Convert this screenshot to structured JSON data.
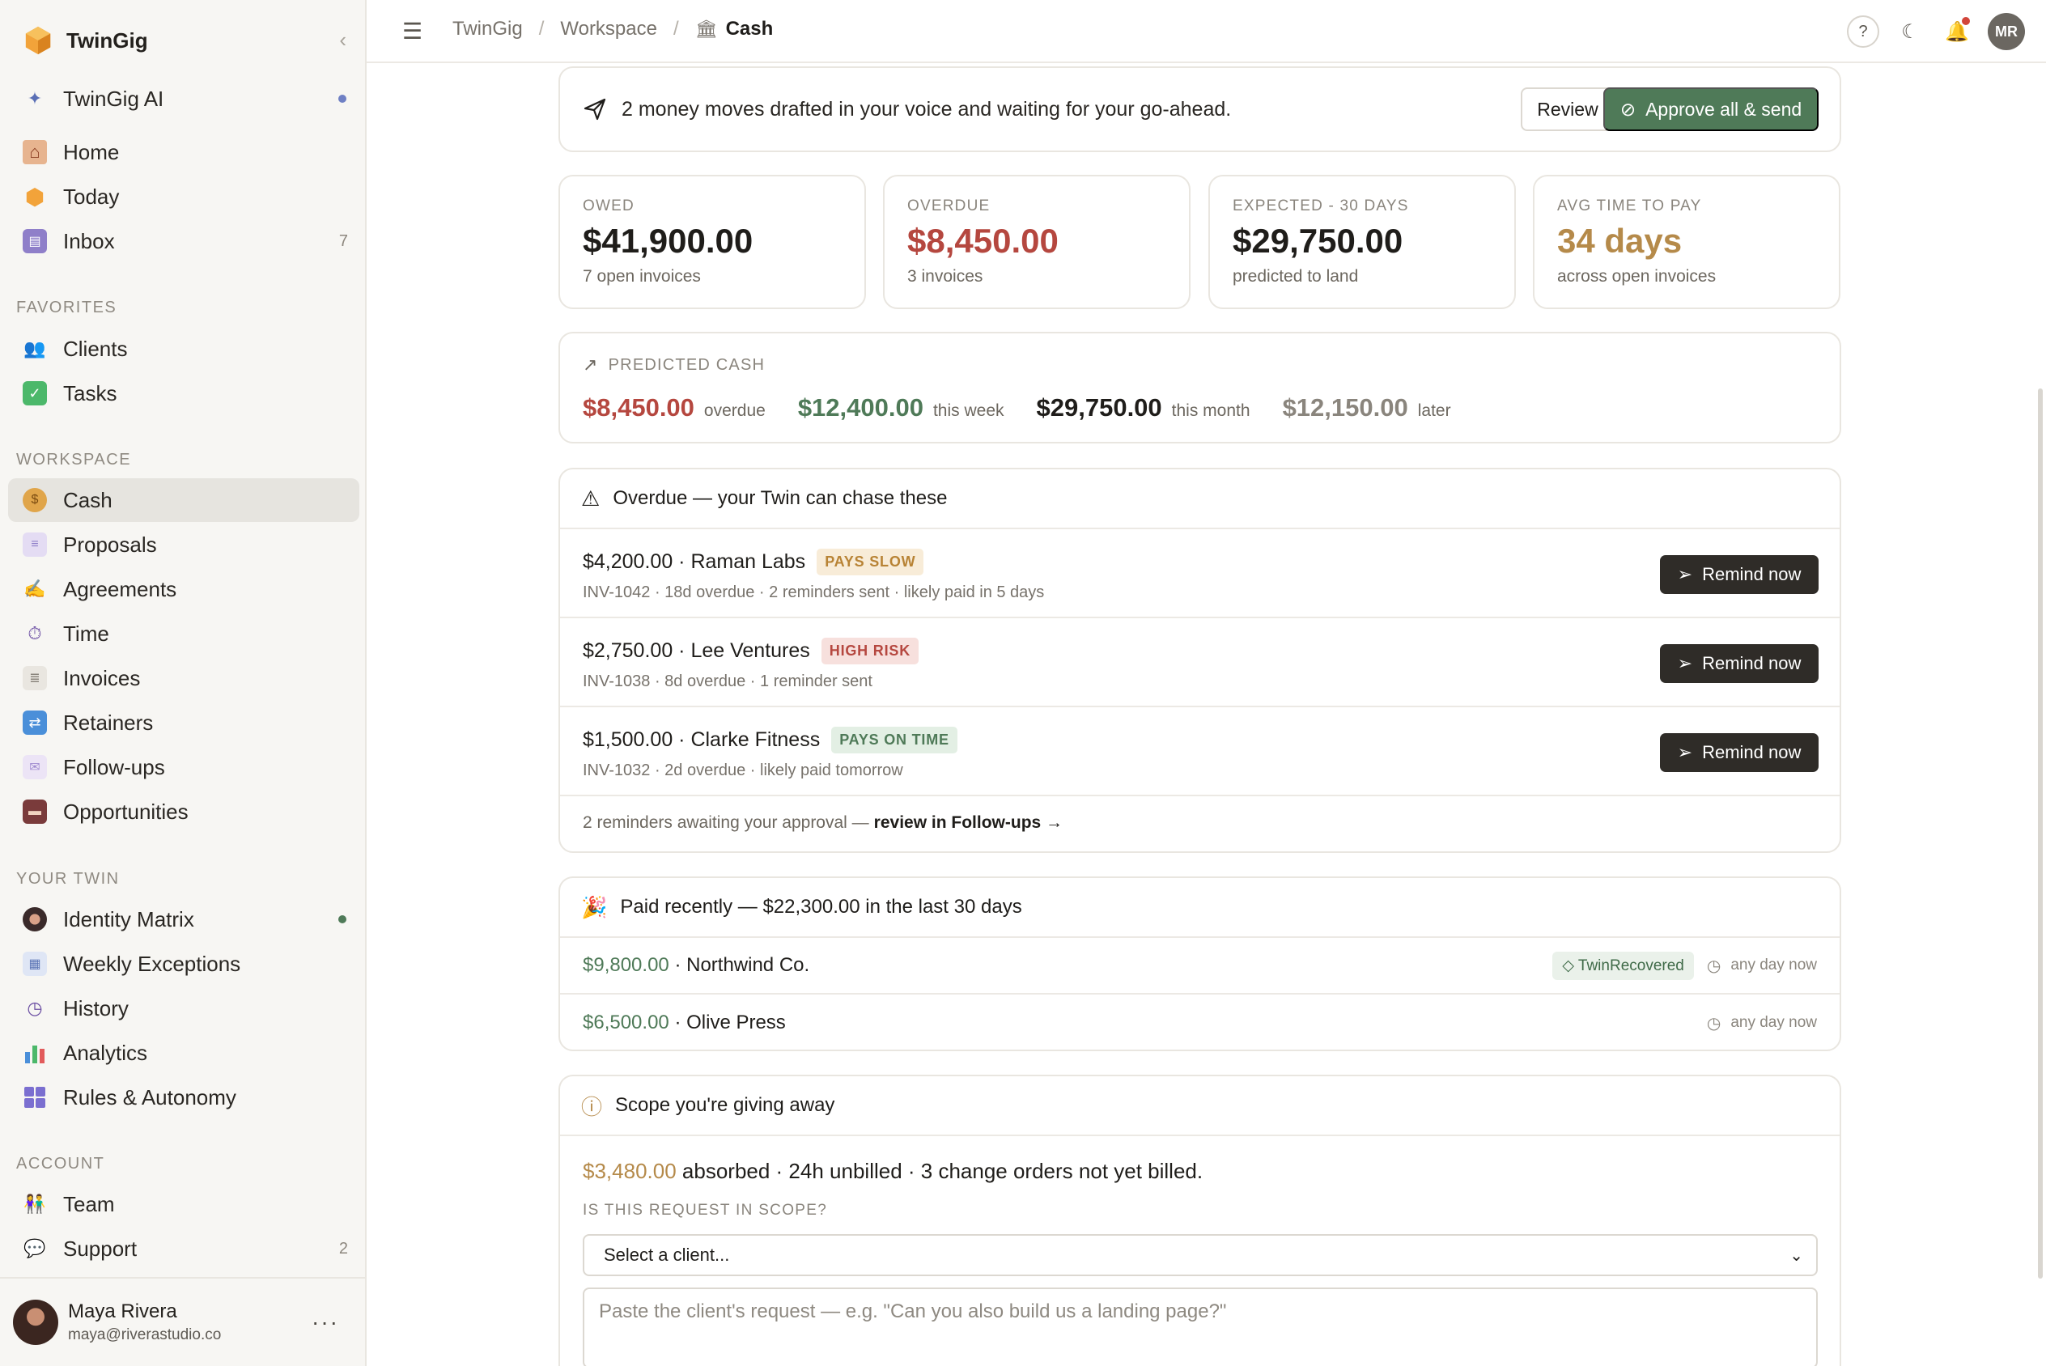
{
  "app": {
    "name": "TwinGig"
  },
  "sidebar": {
    "ai_item": {
      "label": "TwinGig AI"
    },
    "top_items": [
      {
        "label": "Home",
        "icon": "house-icon"
      },
      {
        "label": "Today",
        "icon": "hexagon-icon"
      },
      {
        "label": "Inbox",
        "icon": "inbox-icon",
        "count": "7"
      }
    ],
    "sections": {
      "favorites": "FAVORITES",
      "workspace": "WORKSPACE",
      "your_twin": "YOUR TWIN",
      "account": "ACCOUNT"
    },
    "favorites": [
      {
        "label": "Clients",
        "icon": "people-icon"
      },
      {
        "label": "Tasks",
        "icon": "check-box-icon"
      }
    ],
    "workspace": [
      {
        "label": "Cash",
        "icon": "money-bag-icon",
        "active": true
      },
      {
        "label": "Proposals",
        "icon": "document-icon"
      },
      {
        "label": "Agreements",
        "icon": "writing-hand-icon"
      },
      {
        "label": "Time",
        "icon": "stopwatch-icon"
      },
      {
        "label": "Invoices",
        "icon": "receipt-icon"
      },
      {
        "label": "Retainers",
        "icon": "repeat-icon"
      },
      {
        "label": "Follow-ups",
        "icon": "envelope-icon"
      },
      {
        "label": "Opportunities",
        "icon": "briefcase-icon"
      }
    ],
    "your_twin": [
      {
        "label": "Identity Matrix",
        "icon": "identity-icon"
      },
      {
        "label": "Weekly Exceptions",
        "icon": "calendar-icon"
      },
      {
        "label": "History",
        "icon": "clock-icon"
      },
      {
        "label": "Analytics",
        "icon": "bar-chart-icon"
      },
      {
        "label": "Rules & Autonomy",
        "icon": "grid-icon"
      }
    ],
    "account": [
      {
        "label": "Team",
        "icon": "team-icon"
      },
      {
        "label": "Support",
        "icon": "speech-bubble-icon",
        "count": "2"
      }
    ],
    "user": {
      "name": "Maya Rivera",
      "email": "maya@riverastudio.co"
    }
  },
  "topbar": {
    "breadcrumb": [
      "TwinGig",
      "Workspace",
      "Cash"
    ],
    "initials": "MR"
  },
  "banner": {
    "text": "2 money moves drafted in your voice and waiting for your go-ahead.",
    "review_label": "Review",
    "approve_label": "Approve all & send"
  },
  "kpis": [
    {
      "label": "OWED",
      "value": "$41,900.00",
      "sub": "7 open invoices",
      "color": "#1f1d1a"
    },
    {
      "label": "OVERDUE",
      "value": "$8,450.00",
      "sub": "3 invoices",
      "color": "#b5473f"
    },
    {
      "label": "EXPECTED - 30 DAYS",
      "value": "$29,750.00",
      "sub": "predicted to land",
      "color": "#1f1d1a"
    },
    {
      "label": "AVG TIME TO PAY",
      "value": "34 days",
      "sub": "across open invoices",
      "color": "#b58a4a"
    }
  ],
  "predicted": {
    "title": "PREDICTED CASH",
    "buckets": [
      {
        "amount": "$8,450.00",
        "label": "overdue",
        "color": "#b5473f"
      },
      {
        "amount": "$12,400.00",
        "label": "this week",
        "color": "#4f7a58"
      },
      {
        "amount": "$29,750.00",
        "label": "this month",
        "color": "#1f1d1a"
      },
      {
        "amount": "$12,150.00",
        "label": "later",
        "color": "#8a857d"
      }
    ]
  },
  "overdue": {
    "title": "Overdue — your Twin can chase these",
    "remind_label": "Remind now",
    "rows": [
      {
        "amount": "$4,200.00",
        "client": "Raman Labs",
        "badge": "PAYS SLOW",
        "badge_bg": "#f8ecd8",
        "badge_fg": "#b88335",
        "meta": "INV-1042 · 18d overdue · 2 reminders sent · likely paid in 5 days"
      },
      {
        "amount": "$2,750.00",
        "client": "Lee Ventures",
        "badge": "HIGH RISK",
        "badge_bg": "#f7e0dd",
        "badge_fg": "#b5473f",
        "meta": "INV-1038 · 8d overdue · 1 reminder sent"
      },
      {
        "amount": "$1,500.00",
        "client": "Clarke Fitness",
        "badge": "PAYS ON TIME",
        "badge_bg": "#e3efe4",
        "badge_fg": "#4f7a58",
        "meta": "INV-1032 · 2d overdue · likely paid tomorrow"
      }
    ],
    "footer_text": "2 reminders awaiting your approval —",
    "footer_link": "review in Follow-ups →"
  },
  "paid": {
    "title": "Paid recently — $22,300.00 in the last 30 days",
    "rows": [
      {
        "amount": "$9,800.00",
        "client": "Northwind Co.",
        "badge": "TwinRecovered",
        "when": "any day now"
      },
      {
        "amount": "$6,500.00",
        "client": "Olive Press",
        "badge": "",
        "when": "any day now"
      }
    ]
  },
  "scope": {
    "title": "Scope you're giving away",
    "absorbed": "$3,480.00",
    "summary": "absorbed · 24h unbilled · 3 change orders not yet billed.",
    "question": "IS THIS REQUEST IN SCOPE?",
    "select_value": "Select a client...",
    "textarea_placeholder": "Paste the client's request — e.g. \"Can you also build us a landing page?\""
  }
}
